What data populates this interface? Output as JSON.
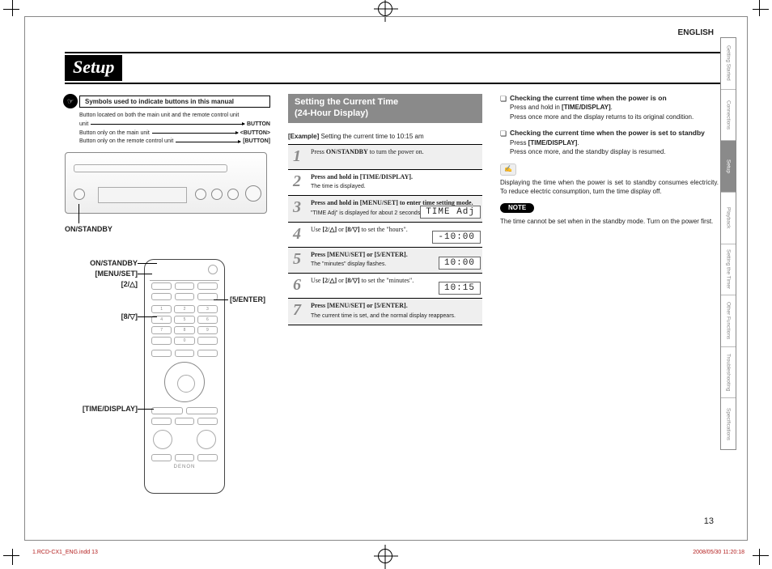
{
  "lang": "ENGLISH",
  "title": "Setup",
  "symbols_title": "Symbols used to indicate buttons in this manual",
  "legend": {
    "both": "Button located on both the main unit and the remote control unit",
    "both_mark": "BUTTON",
    "main": "Button only on the main unit",
    "main_mark": "<BUTTON>",
    "remote": "Button only on the remote control unit",
    "remote_mark": "[BUTTON]"
  },
  "unit_label": "ON/STANDBY",
  "remote_labels": {
    "on_standby": "ON/STANDBY",
    "menu_set": "[MENU/SET]",
    "two_up": "[2/△]",
    "eight_down": "[8/▽]",
    "five_enter": "[5/ENTER]",
    "time_display": "[TIME/DISPLAY]"
  },
  "remote_logo": "DENON",
  "section_title1": "Setting the Current Time",
  "section_title2": "(24-Hour Display)",
  "example_label": "[Example]",
  "example_text": "Setting the current time to 10:15 am",
  "steps": [
    {
      "num": "1",
      "alt": true,
      "text": "Press <b>ON/STANDBY</b> to turn the power on."
    },
    {
      "num": "2",
      "alt": false,
      "text": "<b>Press and hold in [TIME/DISPLAY].</b>",
      "sub": "The time is displayed."
    },
    {
      "num": "3",
      "alt": true,
      "text": "<b>Press and hold in [MENU/SET] to enter time setting mode.</b>",
      "sub": "\"TIME Adj\" is displayed for about 2 seconds.",
      "disp": "TIME Adj"
    },
    {
      "num": "4",
      "alt": false,
      "text": "Use <b>[2/△]</b> or <b>[8/▽]</b> to set the \"hours\".",
      "disp": "-10:00"
    },
    {
      "num": "5",
      "alt": true,
      "text": "<b>Press [MENU/SET] or [5/ENTER].</b>",
      "sub": "The \"minutes\" display flashes.",
      "disp": "10:00"
    },
    {
      "num": "6",
      "alt": false,
      "text": "Use <b>[2/△]</b> or <b>[8/▽]</b> to set the \"minutes\".",
      "disp": "10:15"
    },
    {
      "num": "7",
      "alt": true,
      "text": "<b>Press [MENU/SET] or [5/ENTER].</b>",
      "sub": "The current time is set, and the normal display reappears."
    }
  ],
  "check1": {
    "h": "Checking the current time when the power is on",
    "s1": "Press and hold in <b>[TIME/DISPLAY]</b>.",
    "s2": "Press once more and the display returns to its original condition."
  },
  "check2": {
    "h": "Checking the current time when the power is set to standby",
    "s1": "Press <b>[TIME/DISPLAY]</b>.",
    "s2": "Press once more, and the standby display is resumed."
  },
  "hand_icon": "✍",
  "standby_para": "Displaying the time when the power is set to standby consumes electricity. To reduce electric consumption, turn the time display off.",
  "note_label": "NOTE",
  "note_text": "The time cannot be set when in the standby mode. Turn on the power first.",
  "tabs": [
    "Getting Started",
    "Connections",
    "Setup",
    "Playback",
    "Setting the Timer",
    "Other Functions",
    "Troubleshooting",
    "Specifications"
  ],
  "page_number": "13",
  "footer_left": "1.RCD-CX1_ENG.indd   13",
  "footer_right": "2008/05/30   11:20:18"
}
